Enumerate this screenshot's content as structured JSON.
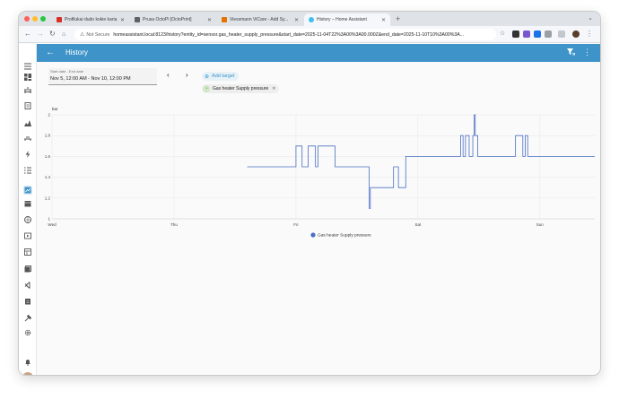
{
  "browser": {
    "tabs": [
      {
        "title": "Profilukai dudo kokie karia - ...",
        "color": "#d93025"
      },
      {
        "title": "Prusa OctoPi [OctoPrint]",
        "color": "#5f6368"
      },
      {
        "title": "Viessmann ViCare - Add Sy...",
        "color": "#e37400"
      },
      {
        "title": "History – Home Assistant",
        "color": "#41bdf5"
      }
    ],
    "new_tab_label": "+",
    "security_label": "Not Secure",
    "url": "homeassistant.local:8123/history?entity_id=sensor.gas_heater_supply_pressure&start_date=2025-11-04T22%3A00%3A00.000Z&end_date=2025-11-10T10%3A00%3A..."
  },
  "app": {
    "page_title": "History",
    "date_picker": {
      "label": "Start date - End date",
      "value": "Nov 5, 12:00 AM - Nov 10, 12:00 PM"
    },
    "add_target_label": "Add target",
    "entity_chip": "Gas heater Supply pressure",
    "accent": "#3e94c8"
  },
  "chart_data": {
    "type": "line",
    "yunit": "bar",
    "ylim": [
      1,
      2
    ],
    "yticks": [
      "1",
      "1.2",
      "1.4",
      "1.6",
      "1.8",
      "2"
    ],
    "xticks": [
      "Wed",
      "Thu",
      "Fri",
      "Sat",
      "Sun"
    ],
    "xlim": [
      0,
      4.45
    ],
    "legend": "Gas heater Supply pressure",
    "series_color": "#4a6fc4",
    "series": [
      {
        "name": "Gas heater Supply pressure",
        "points": [
          [
            1.6,
            1.5
          ],
          [
            2.0,
            1.5
          ],
          [
            2.0,
            1.7
          ],
          [
            2.05,
            1.7
          ],
          [
            2.05,
            1.5
          ],
          [
            2.1,
            1.5
          ],
          [
            2.1,
            1.7
          ],
          [
            2.16,
            1.7
          ],
          [
            2.16,
            1.5
          ],
          [
            2.18,
            1.5
          ],
          [
            2.18,
            1.7
          ],
          [
            2.32,
            1.7
          ],
          [
            2.32,
            1.5
          ],
          [
            2.6,
            1.5
          ],
          [
            2.6,
            1.1
          ],
          [
            2.61,
            1.1
          ],
          [
            2.61,
            1.3
          ],
          [
            2.8,
            1.3
          ],
          [
            2.8,
            1.5
          ],
          [
            2.84,
            1.5
          ],
          [
            2.84,
            1.3
          ],
          [
            2.9,
            1.3
          ],
          [
            2.9,
            1.6
          ],
          [
            3.35,
            1.6
          ],
          [
            3.35,
            1.8
          ],
          [
            3.37,
            1.8
          ],
          [
            3.37,
            1.6
          ],
          [
            3.39,
            1.6
          ],
          [
            3.39,
            1.8
          ],
          [
            3.42,
            1.8
          ],
          [
            3.42,
            1.6
          ],
          [
            3.45,
            1.6
          ],
          [
            3.45,
            1.8
          ],
          [
            3.46,
            1.8
          ],
          [
            3.46,
            2.0
          ],
          [
            3.47,
            2.0
          ],
          [
            3.47,
            1.8
          ],
          [
            3.49,
            1.8
          ],
          [
            3.49,
            1.6
          ],
          [
            3.8,
            1.6
          ],
          [
            3.8,
            1.8
          ],
          [
            3.86,
            1.8
          ],
          [
            3.86,
            1.6
          ],
          [
            3.88,
            1.6
          ],
          [
            3.88,
            1.8
          ],
          [
            3.9,
            1.8
          ],
          [
            3.9,
            1.6
          ],
          [
            4.45,
            1.6
          ]
        ]
      }
    ]
  },
  "sidebar_icons": [
    "menu-icon",
    "overview-icon",
    "energy-icon",
    "logbook-icon",
    "map-icon",
    "vacuum-icon",
    "lightning-icon",
    "todo-icon",
    "history-icon",
    "calendar-icon",
    "globe-icon",
    "media-icon",
    "entities-icon",
    "photos-icon",
    "vscode-icon",
    "tasks-icon",
    "hammer-icon",
    "settings-icon",
    "bell-icon"
  ]
}
